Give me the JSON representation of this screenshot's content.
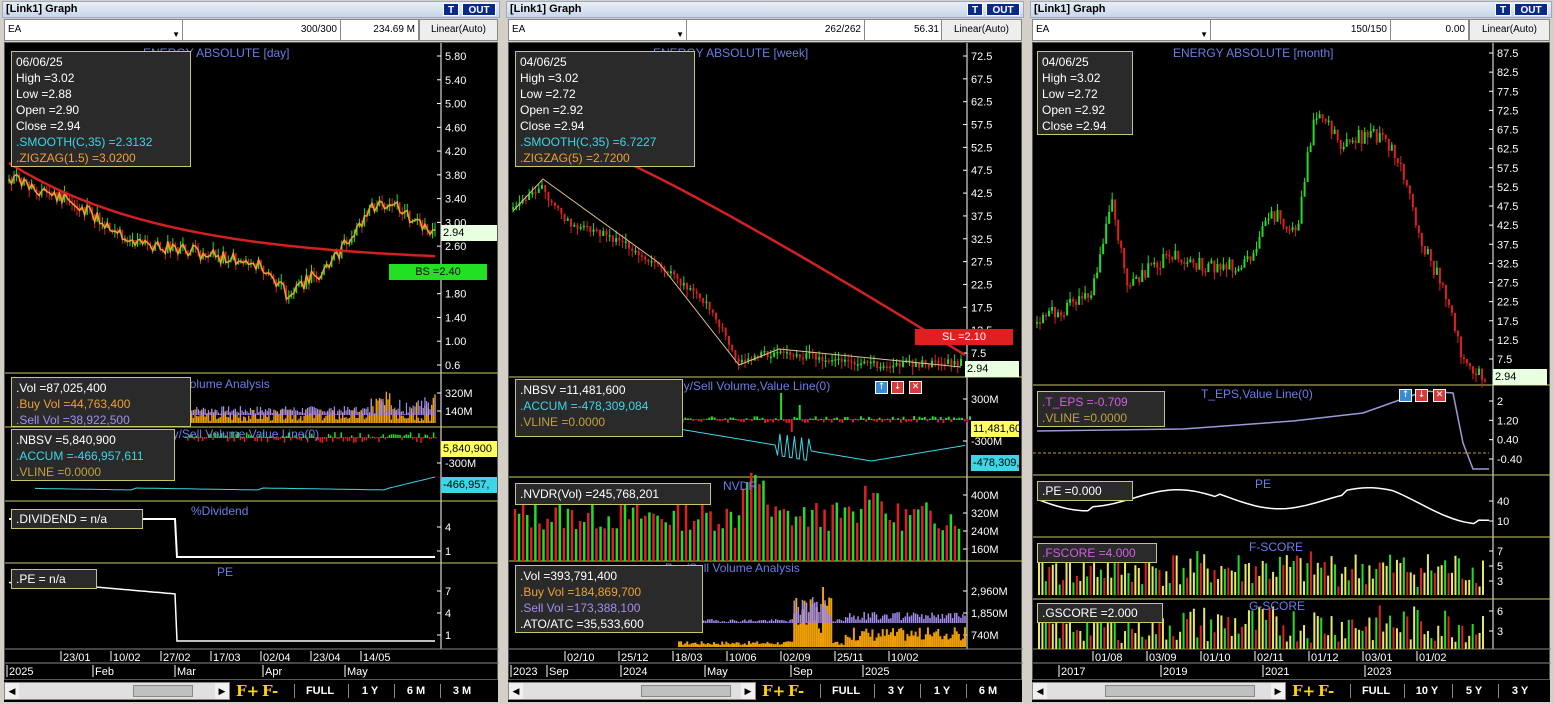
{
  "colors": {
    "up": "#22dd22",
    "down": "#e02020",
    "smooth": "#d42020",
    "zigzag": "#f0a030",
    "buy": "#f0a000",
    "sell": "#a58cf0",
    "accum": "#3cd6e6",
    "white": "#ffffff",
    "axis_text": "#ffffff",
    "label": "#6a7ee8"
  },
  "panels": [
    {
      "title": "[Link1] Graph",
      "btn_t": "T",
      "btn_out": "OUT",
      "symbol": "EA",
      "count": "300/300",
      "volume": "234.69 M",
      "scale": "Linear(Auto)",
      "chart_title": "ENERGY ABSOLUTE [day]",
      "info": {
        "date": "06/06/25",
        "high": "High =3.02",
        "low": "Low =2.88",
        "open": "Open =2.90",
        "close": "Close =2.94",
        "smooth": ".SMOOTH(C,35) =2.3132",
        "zigzag": ".ZIGZAG(1.5) =3.0200"
      },
      "price_axis": [
        "5.80",
        "5.40",
        "5.00",
        "4.60",
        "4.20",
        "3.80",
        "3.40",
        "3.00",
        "2.60",
        "2.20",
        "1.80",
        "1.40",
        "1.00",
        "0.6"
      ],
      "price_tag": "2.94",
      "bs_tag": "BS =2.40",
      "vol": {
        "vol": ".Vol =87,025,400",
        "buy": ".Buy Vol =44,763,400",
        "sell": ".Sell Vol =38,922,500",
        "title": "Buy/Sell Volume Analysis",
        "axis": [
          "320M",
          "140M"
        ]
      },
      "nbsv": {
        "nbsv": ".NBSV =5,840,900",
        "accum": ".ACCUM =-466,957,611",
        "vline": ".VLINE =0.0000",
        "title": "NBSV,Buy/Sell Volume,Value Line(0)",
        "axis": [
          "-300M"
        ],
        "tag_nbsv": "5,840,900",
        "tag_accum": "-466,957,"
      },
      "div": {
        "label": ".DIVIDEND = n/a",
        "title": "%Dividend",
        "axis": [
          "4",
          "1"
        ]
      },
      "pe": {
        "label": ".PE = n/a",
        "title": "PE",
        "axis": [
          "7",
          "4",
          "1"
        ]
      },
      "x_top": [
        "23/01",
        "10/02",
        "27/02",
        "17/03",
        "02/04",
        "23/04",
        "14/05"
      ],
      "x_bot": [
        "2025",
        "Feb",
        "Mar",
        "Apr",
        "May"
      ],
      "buttons": [
        "FULL",
        "1 Y",
        "6 M",
        "3 M"
      ],
      "fbtn": [
        "F+",
        "F-"
      ]
    },
    {
      "title": "[Link1] Graph",
      "btn_t": "T",
      "btn_out": "OUT",
      "symbol": "EA",
      "count": "262/262",
      "volume": "56.31",
      "scale": "Linear(Auto)",
      "chart_title": "ENERGY ABSOLUTE [week]",
      "info": {
        "date": "04/06/25",
        "high": "High =3.02",
        "low": "Low =2.72",
        "open": "Open =2.92",
        "close": "Close =2.94",
        "smooth": ".SMOOTH(C,35) =6.7227",
        "zigzag": ".ZIGZAG(5) =2.7200"
      },
      "price_axis": [
        "72.5",
        "67.5",
        "62.5",
        "57.5",
        "52.5",
        "47.5",
        "42.5",
        "37.5",
        "32.5",
        "27.5",
        "22.5",
        "17.5",
        "12.5",
        "7.5"
      ],
      "price_tag": "2.94",
      "sl_tag": "SL =2.10",
      "nbsv": {
        "nbsv": ".NBSV =11,481,600",
        "accum": ".ACCUM =-478,309,084",
        "vline": ".VLINE =0.0000",
        "title": "Buy/Sell Volume,Value Line(0)",
        "axis": [
          "300M",
          "-300M"
        ],
        "tag_nbsv": "11,481,60",
        "tag_accum": "-478,309,("
      },
      "nvdr": {
        "label": ".NVDR(Vol) =245,768,201",
        "title": "NVDR",
        "axis": [
          "400M",
          "320M",
          "240M",
          "160M"
        ]
      },
      "vol": {
        "vol": ".Vol =393,791,400",
        "buy": ".Buy Vol =184,869,700",
        "sell": ".Sell Vol =173,388,100",
        "ato": ".ATO/ATC =35,533,600",
        "title": "Buy/Sell Volume Analysis",
        "axis": [
          "2,960M",
          "1,850M",
          "740M"
        ]
      },
      "x_top": [
        "02/10",
        "25/12",
        "18/03",
        "10/06",
        "02/09",
        "25/11",
        "10/02"
      ],
      "x_bot": [
        "2023",
        "Sep",
        "2024",
        "May",
        "Sep",
        "2025"
      ],
      "buttons": [
        "FULL",
        "3 Y",
        "1 Y",
        "6 M"
      ],
      "fbtn": [
        "F+",
        "F-"
      ]
    },
    {
      "title": "[Link1] Graph",
      "btn_t": "T",
      "btn_out": "OUT",
      "symbol": "EA",
      "count": "150/150",
      "volume": "0.00",
      "scale": "Linear(Auto)",
      "chart_title": "ENERGY ABSOLUTE [month]",
      "info": {
        "date": "04/06/25",
        "high": "High =3.02",
        "low": "Low =2.72",
        "open": "Open =2.92",
        "close": "Close =2.94"
      },
      "price_axis": [
        "87.5",
        "82.5",
        "77.5",
        "72.5",
        "67.5",
        "62.5",
        "57.5",
        "52.5",
        "47.5",
        "42.5",
        "37.5",
        "32.5",
        "27.5",
        "22.5",
        "17.5",
        "12.5",
        "7.5"
      ],
      "price_tag": "2.94",
      "teps": {
        "label1": ".T_EPS =-0.709",
        "label2": ".VLINE =0.0000",
        "title": "T_EPS,Value Line(0)",
        "axis": [
          "2",
          "1.20",
          "0.40",
          "-0.40"
        ]
      },
      "pe": {
        "label": ".PE =0.000",
        "title": "PE",
        "axis": [
          "40",
          "10"
        ]
      },
      "fscore": {
        "label": ".FSCORE =4.000",
        "title": "F-SCORE",
        "axis": [
          "7",
          "5",
          "3"
        ]
      },
      "gscore": {
        "label": ".GSCORE =2.000",
        "title": "G-SCORE",
        "axis": [
          "6",
          "3"
        ]
      },
      "x_top": [
        "01/08",
        "03/09",
        "01/10",
        "02/11",
        "01/12",
        "03/01",
        "01/02"
      ],
      "x_bot": [
        "2017",
        "2019",
        "2021",
        "2023"
      ],
      "buttons": [
        "FULL",
        "10 Y",
        "5 Y",
        "3 Y"
      ],
      "fbtn": [
        "F+",
        "F-"
      ]
    }
  ]
}
